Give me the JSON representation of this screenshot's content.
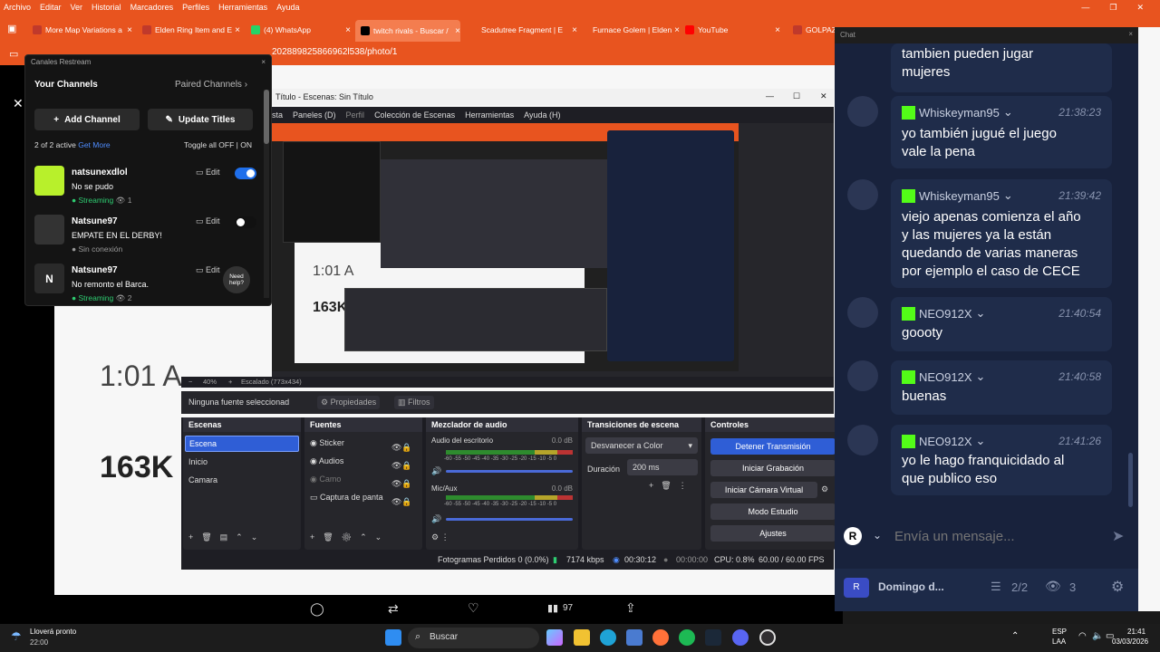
{
  "browser": {
    "menu": [
      "Archivo",
      "Editar",
      "Ver",
      "Historial",
      "Marcadores",
      "Perfiles",
      "Herramientas",
      "Ayuda"
    ],
    "tabs": [
      {
        "label": "More Map Variations a",
        "color": "#c0392b"
      },
      {
        "label": "Elden Ring Item and E",
        "color": "#c0392b"
      },
      {
        "label": "(4) WhatsApp",
        "color": "#25d366"
      },
      {
        "label": "twitch rivals - Buscar /",
        "color": "#000000"
      },
      {
        "label": "Scadutree Fragment | E",
        "color": "#c0392b"
      },
      {
        "label": "Furnace Golem | Elden",
        "color": "#c0392b"
      },
      {
        "label": "YouTube",
        "color": "#ff0000"
      },
      {
        "label": "GOLPAZO",
        "color": "#c0392b"
      }
    ],
    "url": "202889825866962l538/photo/1",
    "accent": "#e8541f"
  },
  "page": {
    "time_text": "1:01 A",
    "views_text": "163K",
    "actions": {
      "likes": "97"
    }
  },
  "restream": {
    "header": "Canales Restream",
    "your_channels": "Your Channels",
    "paired_channels": "Paired Channels",
    "add_channel": "Add Channel",
    "update_titles": "Update Titles",
    "active_text": "2 of 2 active",
    "get_more": "Get More",
    "toggle_all": "Toggle all",
    "off": "OFF",
    "on": "ON",
    "edit": "Edit",
    "need_help": "Need help?",
    "channels": [
      {
        "name": "natsunexdlol",
        "title": "No se pudo",
        "status": "Streaming",
        "viewers": "1",
        "enabled": true
      },
      {
        "name": "Natsune97",
        "title": "EMPATE EN EL DERBY!",
        "status": "Sin conexión",
        "viewers": "",
        "enabled": false
      },
      {
        "name": "Natsune97",
        "title": "No remonto el Barca.",
        "status": "Streaming",
        "viewers": "2",
        "enabled": true
      }
    ]
  },
  "obs": {
    "title": "Título - Escenas: Sin Título",
    "menu": [
      "sta",
      "Paneles (D)",
      "Perfil",
      "Colección de Escenas",
      "Herramientas",
      "Ayuda (H)"
    ],
    "zoom": "40%",
    "scale": "Escalado (773x434)",
    "no_source": "Ninguna fuente seleccionad",
    "properties": "Propiedades",
    "filters": "Filtros",
    "scenes_title": "Escenas",
    "scenes": [
      "Escena",
      "Inicio",
      "Camara"
    ],
    "sources_title": "Fuentes",
    "sources": [
      "Sticker",
      "Audios",
      "Camo",
      "Captura de panta"
    ],
    "mixer_title": "Mezclador de audio",
    "mixer": [
      {
        "name": "Audio del escritorio",
        "db": "0.0 dB"
      },
      {
        "name": "Mic/Aux",
        "db": "0.0 dB"
      }
    ],
    "scale_ticks": "-60 -55 -50 -45 -40 -35 -30 -25 -20 -15 -10 -5 0",
    "transitions_title": "Transiciones de escena",
    "transition": "Desvanecer a Color",
    "duration_label": "Duración",
    "duration": "200 ms",
    "controls_title": "Controles",
    "controls": [
      "Detener Transmisión",
      "Iniciar Grabación",
      "Iniciar Cámara Virtual",
      "Modo Estudio",
      "Ajustes"
    ],
    "status": {
      "dropped": "Fotogramas Perdidos 0 (0.0%)",
      "kbps": "7174 kbps",
      "stream_time": "00:30:12",
      "rec_time": "00:00:00",
      "cpu": "CPU: 0.8%",
      "fps": "60.00 / 60.00 FPS"
    }
  },
  "chat": {
    "header": "Chat",
    "messages": [
      {
        "user": "",
        "time": "",
        "text": [
          "tambien pueden jugar",
          "mujeres"
        ]
      },
      {
        "user": "Whiskeyman95",
        "time": "21:38:23",
        "text": [
          "yo también jugué el juego",
          "vale la pena"
        ]
      },
      {
        "user": "Whiskeyman95",
        "time": "21:39:42",
        "text": [
          "viejo apenas comienza el año",
          "y las mujeres ya la están",
          "quedando de varias maneras",
          "por ejemplo el caso de CECE"
        ]
      },
      {
        "user": "NEO912X",
        "time": "21:40:54",
        "text": [
          "goooty"
        ]
      },
      {
        "user": "NEO912X",
        "time": "21:40:58",
        "text": [
          "buenas"
        ]
      },
      {
        "user": "NEO912X",
        "time": "21:41:26",
        "text": [
          "yo le hago franquicidado al",
          "que publico eso"
        ]
      }
    ],
    "placeholder": "Envía un mensaje...",
    "footer_user": "Domingo d...",
    "footer_channels": "2/2",
    "footer_viewers": "3",
    "kick_green": "#53fc18"
  },
  "taskbar": {
    "weather": "Lloverá pronto",
    "weather_time": "22:00",
    "search": "Buscar",
    "lang": "ESP",
    "lang2": "LAA",
    "time": "21:41",
    "date": "03/03/2026"
  }
}
